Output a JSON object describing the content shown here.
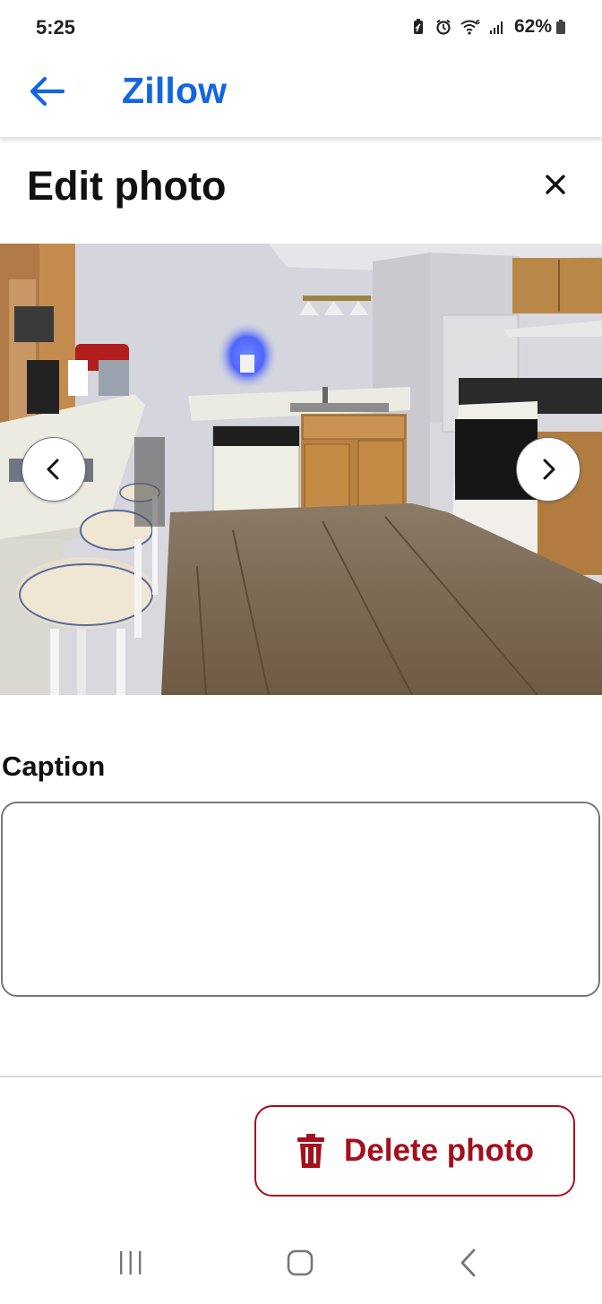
{
  "status_bar": {
    "time": "5:25",
    "battery": "62%",
    "icons": [
      "battery-saver-icon",
      "alarm-icon",
      "wifi-icon",
      "signal-icon",
      "battery-icon"
    ]
  },
  "app_bar": {
    "title": "Zillow",
    "back_icon": "arrow-left-icon",
    "brand_color": "#1466e0"
  },
  "header": {
    "title": "Edit photo",
    "close_icon": "close-icon"
  },
  "photo": {
    "prev_icon": "chevron-left-icon",
    "next_icon": "chevron-right-icon"
  },
  "caption": {
    "label": "Caption",
    "value": "",
    "placeholder": ""
  },
  "actions": {
    "delete_label": "Delete photo",
    "delete_icon": "trash-icon",
    "delete_color": "#a3101c"
  },
  "system_nav": {
    "icons": [
      "recent-apps-icon",
      "home-icon",
      "back-icon"
    ]
  }
}
